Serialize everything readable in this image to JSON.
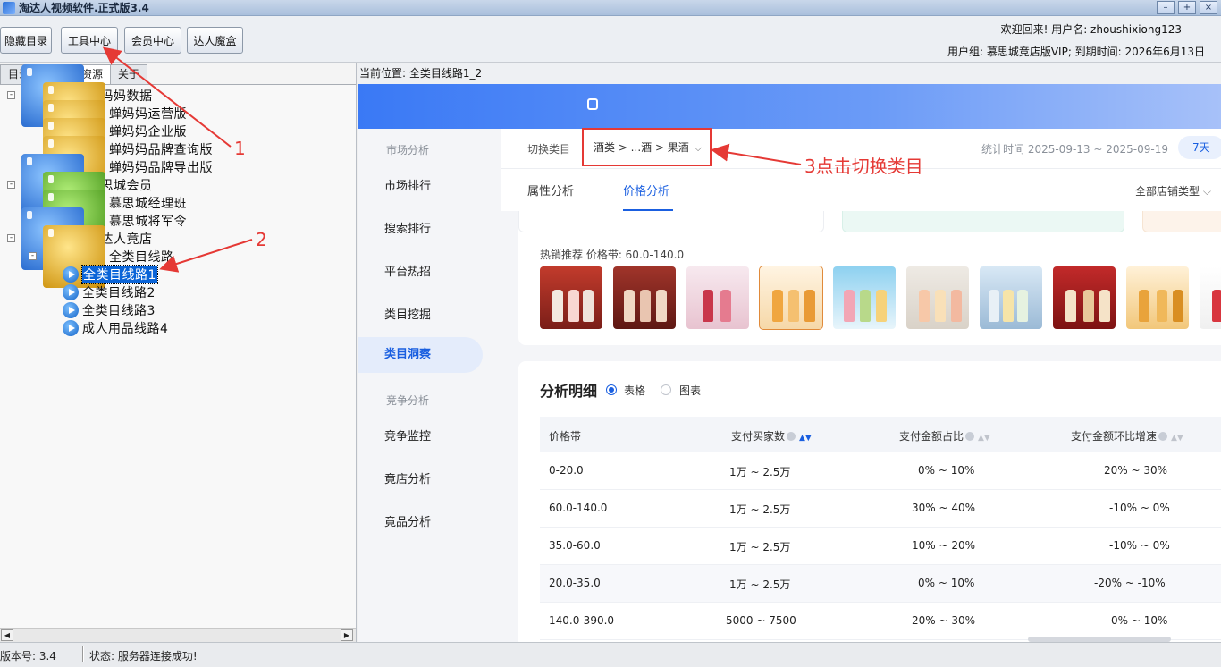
{
  "window": {
    "title": "淘达人视频软件.正式版3.4",
    "controls": [
      "–",
      "+",
      "×"
    ]
  },
  "toolbar": {
    "buttons": [
      "隐藏目录",
      "工具中心",
      "会员中心",
      "达人魔盒"
    ],
    "welcome": "欢迎回来! 用户名: zhoushixiong123",
    "usergroup": "用户组: 慕思城竞店版VIP; 到期时间: 2026年6月13日"
  },
  "left": {
    "tabs": [
      "目录",
      "查找",
      "资源",
      "关于"
    ],
    "tree": [
      "蝉妈妈数据",
      "蝉妈妈运营版",
      "蝉妈妈企业版",
      "蝉妈妈品牌查询版",
      "蝉妈妈品牌导出版",
      "慕思城会员",
      "慕思城经理班",
      "慕思城将军令",
      "淘达人竟店",
      "全类目线路",
      "全类目线路1",
      "全类目线路2",
      "全类目线路3",
      "成人用品线路4"
    ]
  },
  "status": {
    "version": "版本号: 3.4",
    "text": "状态: 服务器连接成功!"
  },
  "right": {
    "breadcrumb": "当前位置: 全类目线路1_2",
    "nav": {
      "sections": [
        "市场分析",
        "竞争分析"
      ],
      "items": [
        "市场排行",
        "搜索排行",
        "平台热招",
        "类目挖掘",
        "类目洞察",
        "竞争监控",
        "竟店分析",
        "竟品分析"
      ]
    },
    "top": {
      "switch_label": "切换类目",
      "category": "酒类 > ...酒 > 果酒",
      "stat_time": "统计时间 2025-09-13 ~ 2025-09-19",
      "days": "7天",
      "subtabs": [
        "属性分析",
        "价格分析"
      ],
      "store_type": "全部店铺类型"
    },
    "hot": {
      "title": "热销推荐 价格带: 60.0-140.0"
    },
    "detail": {
      "title": "分析明细",
      "radio_table": "表格",
      "radio_chart": "图表",
      "columns": [
        "价格带",
        "支付买家数",
        "支付金额占比",
        "支付金额环比增速"
      ],
      "rows": [
        [
          "0-20.0",
          "1万 ~ 2.5万",
          "0% ~ 10%",
          "20% ~ 30%"
        ],
        [
          "60.0-140.0",
          "1万 ~ 2.5万",
          "30% ~ 40%",
          "-10% ~ 0%"
        ],
        [
          "35.0-60.0",
          "1万 ~ 2.5万",
          "10% ~ 20%",
          "-10% ~ 0%"
        ],
        [
          "20.0-35.0",
          "1万 ~ 2.5万",
          "0% ~ 10%",
          "-20% ~ -10%"
        ],
        [
          "140.0-390.0",
          "5000 ~ 7500",
          "20% ~ 30%",
          "0% ~ 10%"
        ]
      ]
    }
  },
  "annotations": {
    "a1": "1",
    "a2": "2",
    "a3": "3点击切换类目"
  },
  "colors": {
    "accent": "#1a5fe0",
    "annotation": "#e53935",
    "selected": "#0a64d8"
  }
}
